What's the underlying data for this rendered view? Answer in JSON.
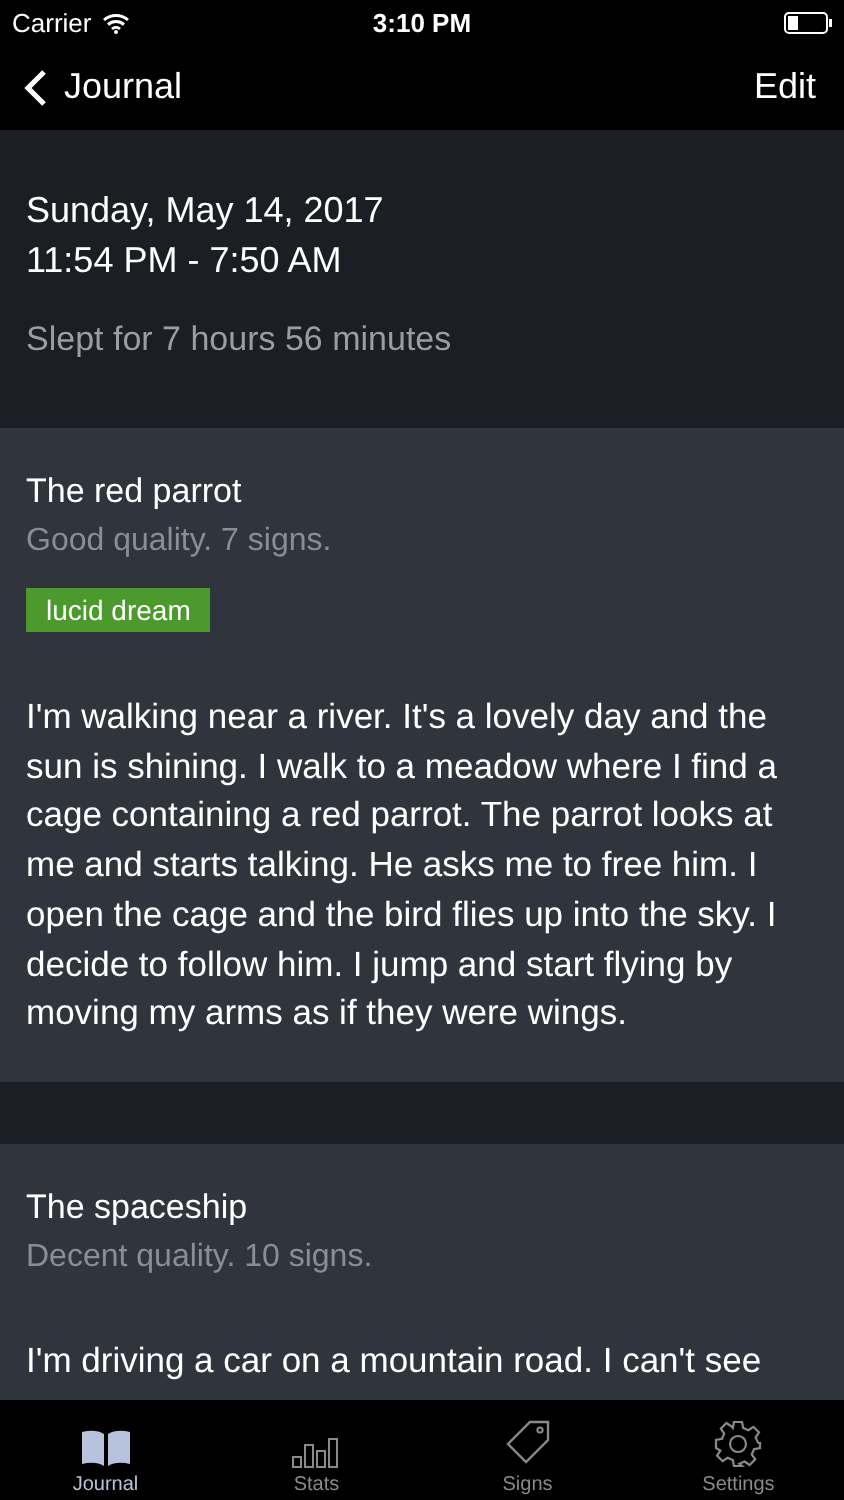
{
  "status_bar": {
    "carrier": "Carrier",
    "time": "3:10 PM"
  },
  "nav": {
    "back": "Journal",
    "action": "Edit"
  },
  "night": {
    "date": "Sunday, May 14, 2017",
    "times": "11:54 PM - 7:50 AM",
    "duration": "Slept for 7 hours 56 minutes"
  },
  "dreams": [
    {
      "title": "The red parrot",
      "meta": "Good quality.  7 signs.",
      "tags": [
        {
          "label": "lucid dream",
          "color": "#4c9a2e"
        }
      ],
      "text": "I'm walking near a river. It's a lovely day and the sun is shining. I walk to a meadow where I find a cage containing a red parrot. The parrot looks at me and starts talking. He asks me to free him. I open the cage and the bird flies up into the sky. I decide to follow him. I jump and start flying by moving my arms as if they were wings."
    },
    {
      "title": "The spaceship",
      "meta": "Decent quality.  10 signs.",
      "text": "I'm driving a car on a mountain road. I can't see"
    }
  ],
  "tabs": [
    {
      "label": "Journal",
      "kind": "book",
      "selected": true
    },
    {
      "label": "Stats",
      "kind": "bars",
      "selected": false
    },
    {
      "label": "Signs",
      "kind": "tag",
      "selected": false
    },
    {
      "label": "Settings",
      "kind": "gear",
      "selected": false
    }
  ]
}
